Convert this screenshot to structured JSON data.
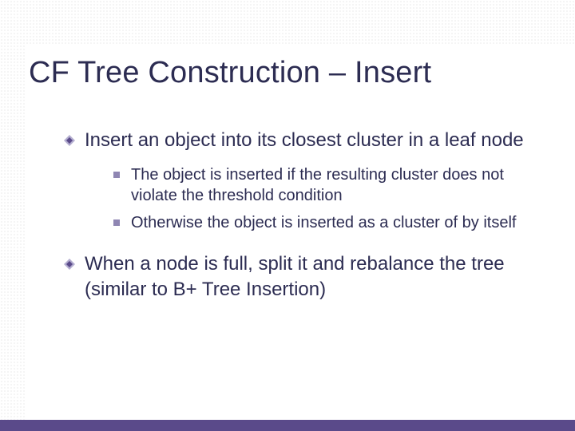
{
  "title": "CF Tree Construction – Insert",
  "bullets": [
    {
      "text": "Insert an object into its closest cluster in a leaf node",
      "sub": [
        "The object is inserted if the resulting cluster does not violate the threshold condition",
        "Otherwise the object is inserted as a cluster of by itself"
      ]
    },
    {
      "text": "When a node is full, split it and rebalance the tree (similar to B+ Tree Insertion)",
      "sub": []
    }
  ]
}
